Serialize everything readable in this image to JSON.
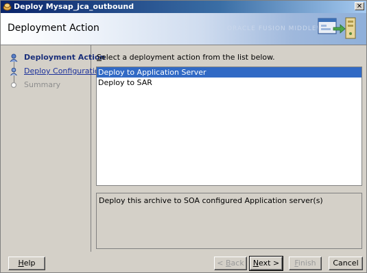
{
  "window": {
    "title": "Deploy Mysap_jca_outbound",
    "close_glyph": "✕"
  },
  "header": {
    "title": "Deployment Action",
    "banner_art": "ORACLE FUSION MIDDLEWARE"
  },
  "steps": [
    {
      "label": "Deployment Action",
      "state": "current"
    },
    {
      "label": "Deploy Configuration",
      "state": "link"
    },
    {
      "label": "Summary",
      "state": "disabled"
    }
  ],
  "main": {
    "instruction_prefix": "S",
    "instruction_rest": "elect a deployment action from the list below.",
    "actions": [
      {
        "label": "Deploy to Application Server",
        "selected": true
      },
      {
        "label": "Deploy to SAR",
        "selected": false
      }
    ],
    "description": "Deploy this archive to SOA configured Application server(s)"
  },
  "buttons": {
    "help_mnemonic": "H",
    "help_rest": "elp",
    "back_prefix": "< ",
    "back_mnemonic": "B",
    "back_rest": "ack",
    "next_mnemonic": "N",
    "next_rest": "ext >",
    "finish_mnemonic": "F",
    "finish_rest": "inish",
    "cancel_label": "Cancel"
  },
  "colors": {
    "selection": "#316ac5",
    "link": "#1a2f9a",
    "titlebar": "#0a246a"
  }
}
